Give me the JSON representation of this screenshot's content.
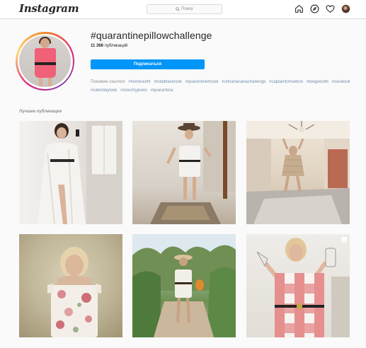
{
  "topbar": {
    "logo": "Instagram",
    "search_placeholder": "Поиск",
    "icons": [
      "home-icon",
      "explore-icon",
      "heart-icon",
      "profile-avatar"
    ]
  },
  "header": {
    "hashtag": "#quarantinepillowchallenge",
    "post_count": "11 366",
    "post_count_label": "публикаций",
    "follow_label": "Подписаться",
    "related_label": "Похожие хэштеги",
    "related_tags": [
      "#homeoutfit",
      "#totalblacklook",
      "#quarantinemood",
      "#ohnanananachallenge",
      "#captaintortueboo",
      "#beigeoutfit",
      "#zaralook",
      "#saturdaylook",
      "#slouchyjeans",
      "#quarantina"
    ]
  },
  "section": {
    "title": "Лучшие публикации"
  },
  "posts": [
    {
      "kind": "photo",
      "multiple": false
    },
    {
      "kind": "photo",
      "multiple": false
    },
    {
      "kind": "photo",
      "multiple": false
    },
    {
      "kind": "photo",
      "multiple": false
    },
    {
      "kind": "photo",
      "multiple": false
    },
    {
      "kind": "photo",
      "multiple": true
    }
  ],
  "colors": {
    "accent": "#0095f6",
    "bg": "#fafafa",
    "border": "#dbdbdb",
    "muted": "#8e8e8e"
  }
}
